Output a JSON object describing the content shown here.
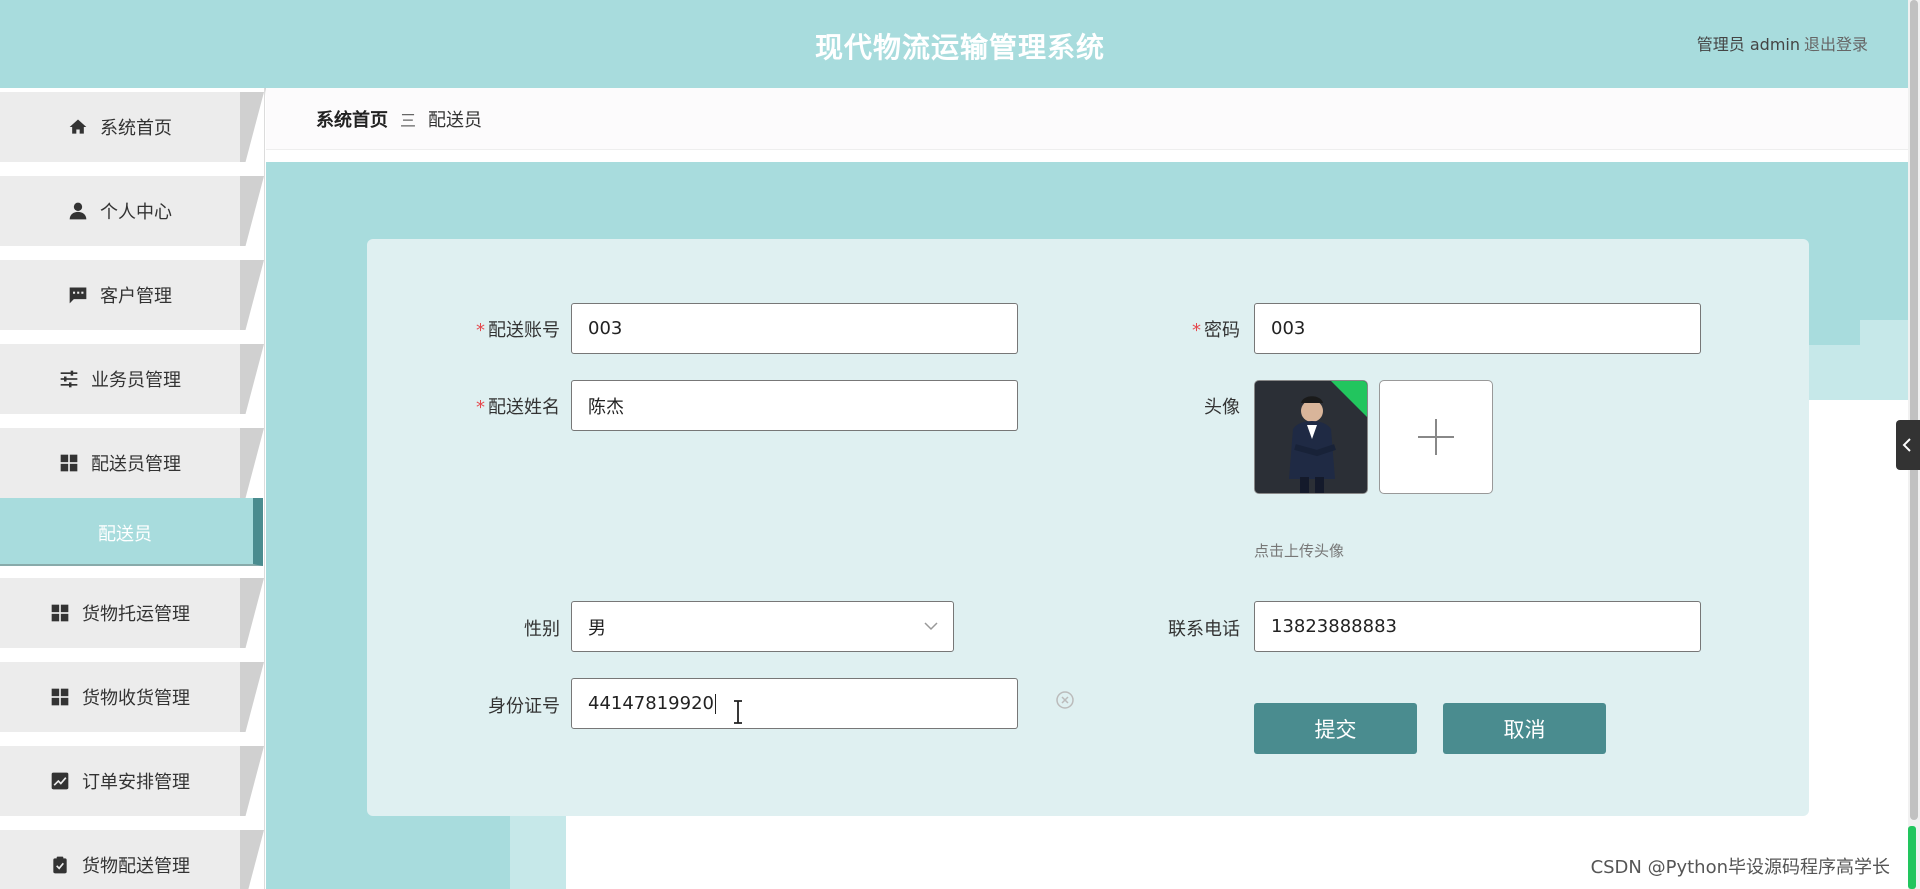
{
  "header": {
    "title": "现代物流运输管理系统",
    "user": "管理员 admin",
    "logout": "退出登录"
  },
  "sidebar": {
    "items": [
      {
        "label": "系统首页",
        "icon": "home-icon"
      },
      {
        "label": "个人中心",
        "icon": "user-icon"
      },
      {
        "label": "客户管理",
        "icon": "chat-icon"
      },
      {
        "label": "业务员管理",
        "icon": "sliders-icon"
      },
      {
        "label": "配送员管理",
        "icon": "grid-icon"
      },
      {
        "label": "货物托运管理",
        "icon": "grid-icon"
      },
      {
        "label": "货物收货管理",
        "icon": "grid-icon"
      },
      {
        "label": "订单安排管理",
        "icon": "chart-icon"
      },
      {
        "label": "货物配送管理",
        "icon": "clipboard-icon"
      }
    ],
    "active_sub": "配送员"
  },
  "breadcrumb": {
    "home": "系统首页",
    "separator": "三",
    "current": "配送员"
  },
  "form": {
    "account_label": "配送账号",
    "account_value": "003",
    "password_label": "密码",
    "password_value": "003",
    "name_label": "配送姓名",
    "name_value": "陈杰",
    "avatar_label": "头像",
    "upload_hint": "点击上传头像",
    "gender_label": "性别",
    "gender_value": "男",
    "phone_label": "联系电话",
    "phone_value": "13823888883",
    "id_label": "身份证号",
    "id_value": "44147819920",
    "required_mark": "*",
    "submit": "提交",
    "cancel": "取消"
  },
  "watermark": "CSDN @Python毕设源码程序高学长",
  "colors": {
    "theme": "#a8dcdd",
    "accent": "#4a8c8f",
    "card": "#dff0f1",
    "required": "#e5484d"
  }
}
